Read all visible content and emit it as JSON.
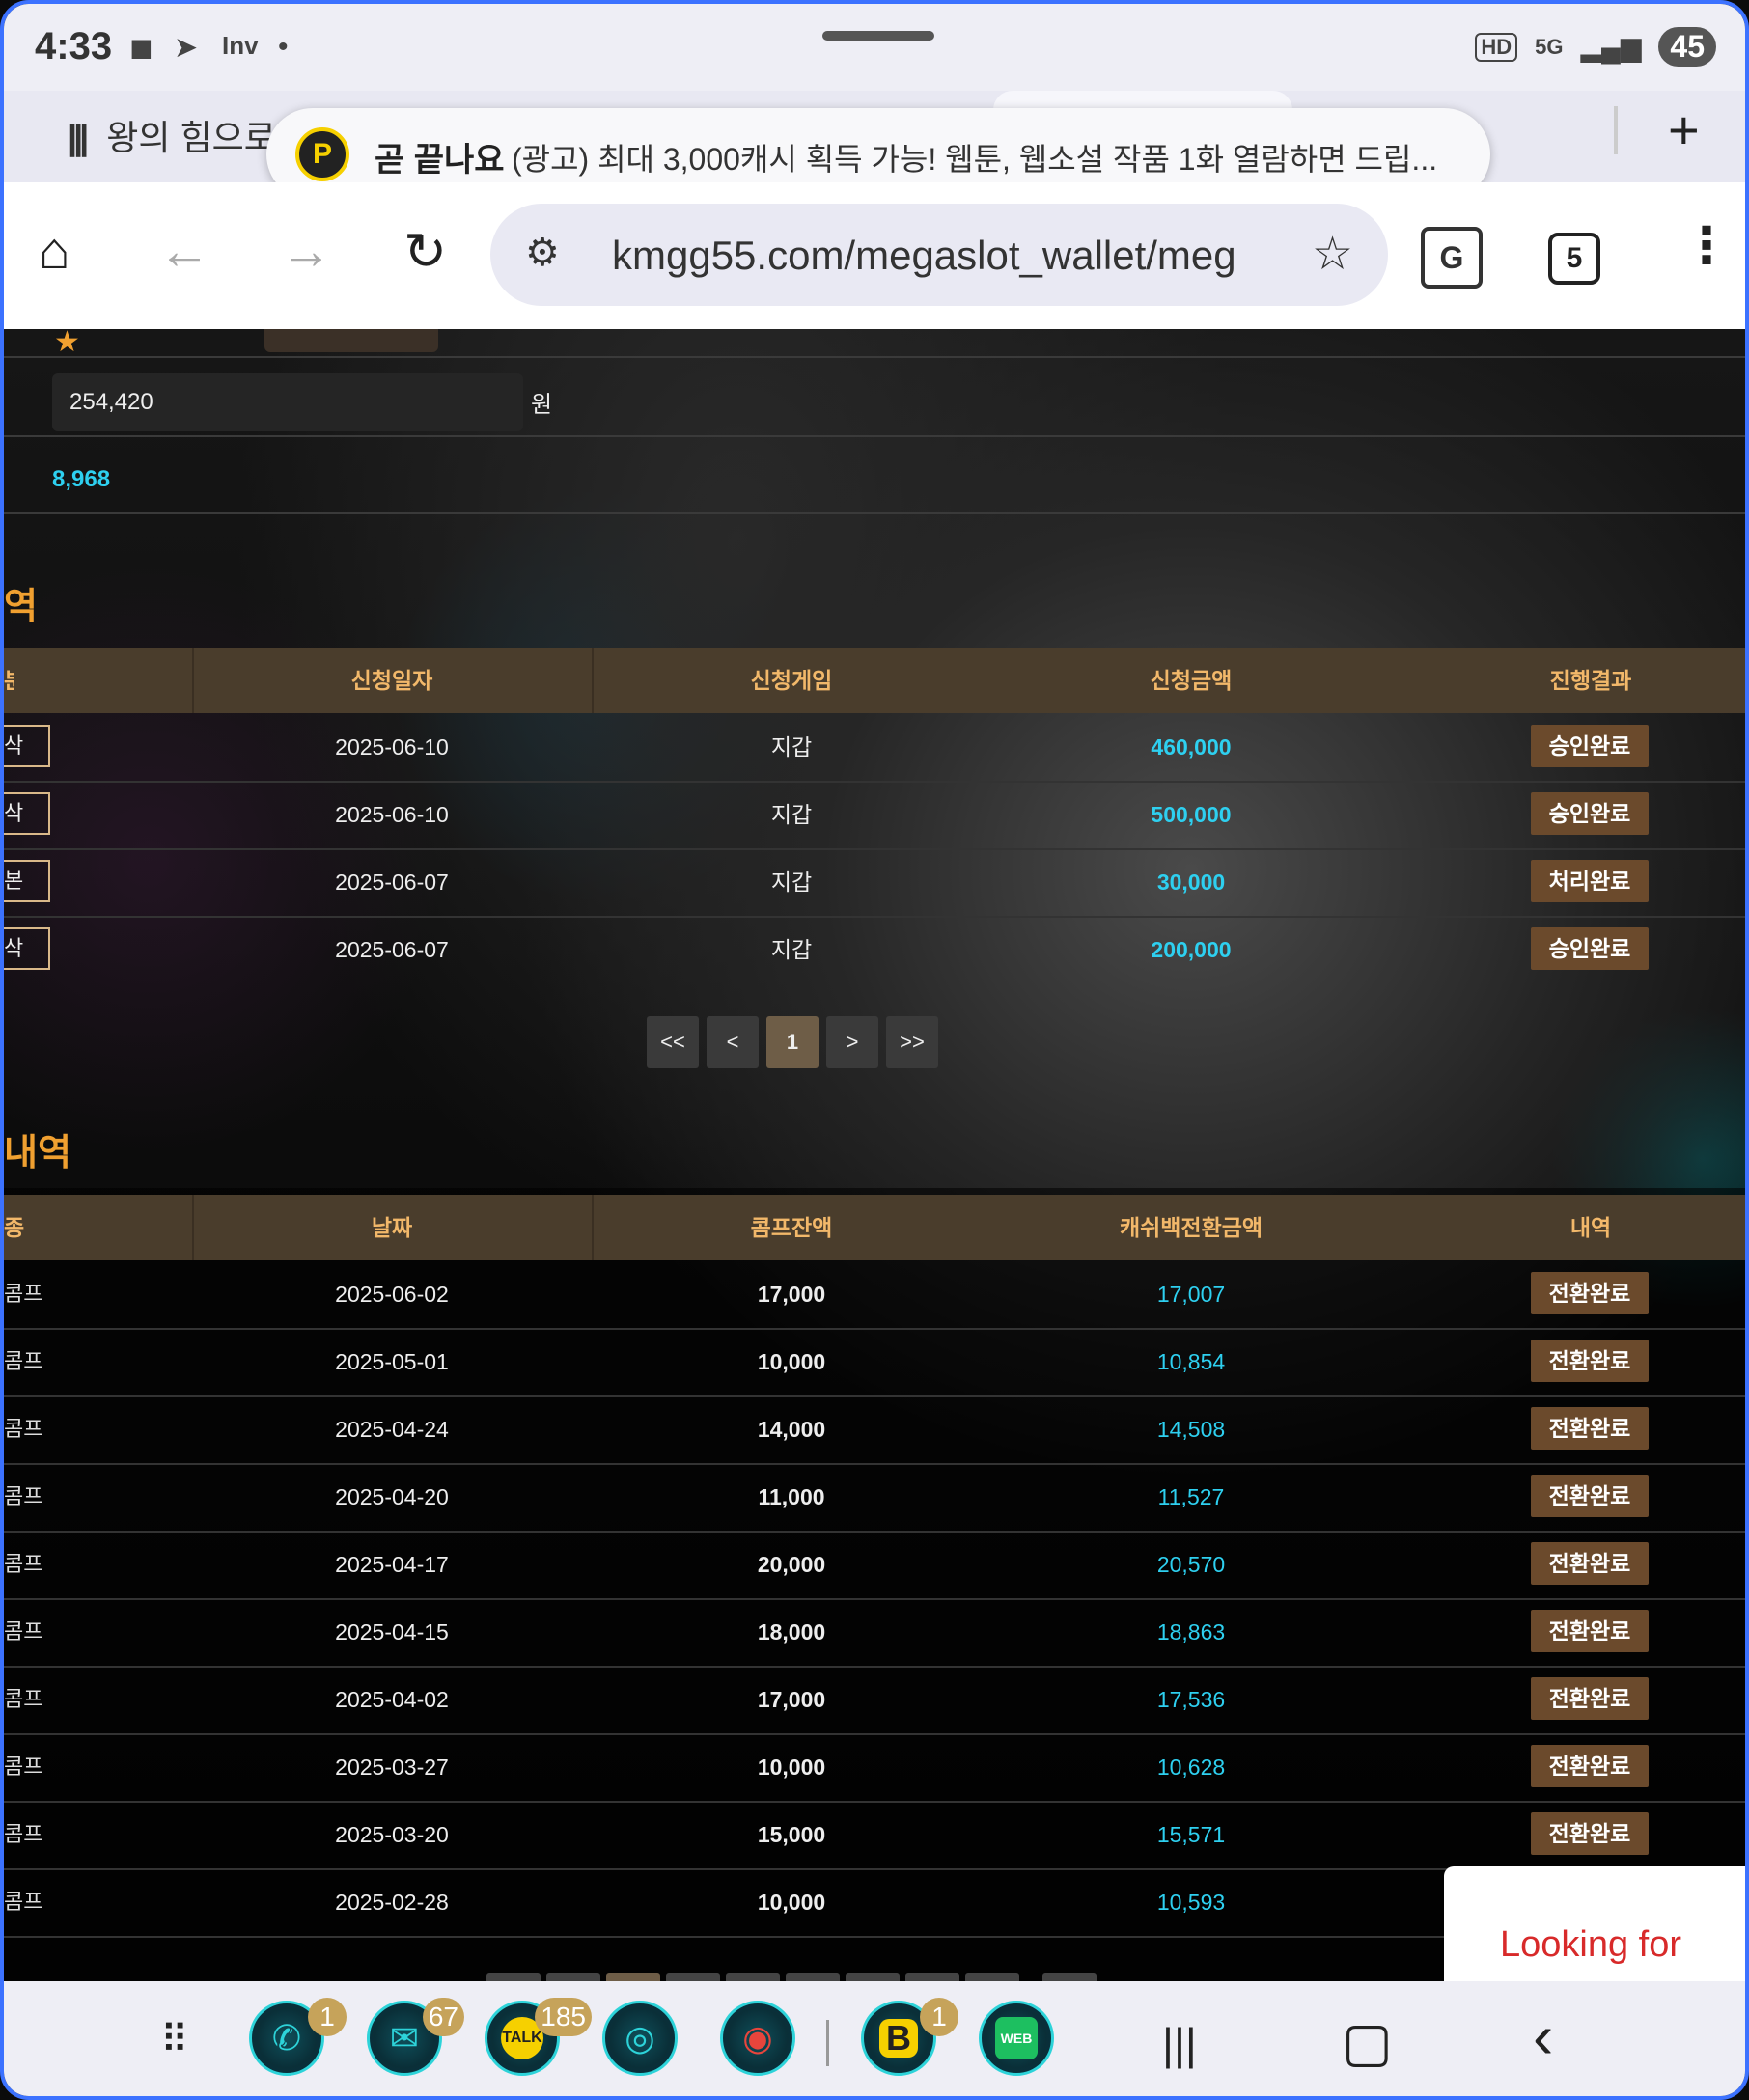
{
  "status_bar": {
    "time": "4:33",
    "left_icons": [
      "notification-square-icon",
      "telegram-icon",
      "inven-icon",
      "dot-icon"
    ],
    "inven_label": "Inv",
    "right_icons": [
      "hd-icon",
      "5g-icon",
      "signal-icon"
    ],
    "hd": "HD",
    "net": "5G",
    "battery": "45"
  },
  "tab": {
    "title": "왕의 힘으로",
    "new_tab": "+"
  },
  "ad": {
    "logo": "P",
    "strong": "곧 끝나요",
    "text": "(광고) 최대 3,000캐시 획득 가능! 웹툰, 웹소설 작품 1화 열람하면 드립..."
  },
  "toolbar": {
    "home": "⌂",
    "back": "←",
    "forward": "→",
    "reload": "↻",
    "url": "kmgg55.com/megaslot_wallet/meg",
    "star": "☆",
    "translate": "G",
    "tabs": "5",
    "menu": "⋮"
  },
  "wallet": {
    "amount": "254,420",
    "currency": "원",
    "point": "8,968"
  },
  "exchange_section": {
    "title_fragment": "역",
    "headers": [
      "분",
      "신청일자",
      "신청게임",
      "신청금액",
      "진행결과"
    ],
    "rows": [
      {
        "type": "삭",
        "date": "2025-06-10",
        "game": "지갑",
        "amount": "460,000",
        "status": "승인완료"
      },
      {
        "type": "삭",
        "date": "2025-06-10",
        "game": "지갑",
        "amount": "500,000",
        "status": "승인완료"
      },
      {
        "type": "본",
        "date": "2025-06-07",
        "game": "지갑",
        "amount": "30,000",
        "status": "처리완료"
      },
      {
        "type": "삭",
        "date": "2025-06-07",
        "game": "지갑",
        "amount": "200,000",
        "status": "승인완료"
      }
    ],
    "pager": [
      "<<",
      "<",
      "1",
      ">",
      ">>"
    ]
  },
  "comp_section": {
    "title_fragment": "내역",
    "headers": [
      "종류",
      "날짜",
      "콤프잔액",
      "캐쉬백전환금액",
      "내역"
    ],
    "rows": [
      {
        "type": "콤프",
        "date": "2025-06-02",
        "balance": "17,000",
        "cashback": "17,007",
        "status": "전환완료"
      },
      {
        "type": "콤프",
        "date": "2025-05-01",
        "balance": "10,000",
        "cashback": "10,854",
        "status": "전환완료"
      },
      {
        "type": "콤프",
        "date": "2025-04-24",
        "balance": "14,000",
        "cashback": "14,508",
        "status": "전환완료"
      },
      {
        "type": "콤프",
        "date": "2025-04-20",
        "balance": "11,000",
        "cashback": "11,527",
        "status": "전환완료"
      },
      {
        "type": "콤프",
        "date": "2025-04-17",
        "balance": "20,000",
        "cashback": "20,570",
        "status": "전환완료"
      },
      {
        "type": "콤프",
        "date": "2025-04-15",
        "balance": "18,000",
        "cashback": "18,863",
        "status": "전환완료"
      },
      {
        "type": "콤프",
        "date": "2025-04-02",
        "balance": "17,000",
        "cashback": "17,536",
        "status": "전환완료"
      },
      {
        "type": "콤프",
        "date": "2025-03-27",
        "balance": "10,000",
        "cashback": "10,628",
        "status": "전환완료"
      },
      {
        "type": "콤프",
        "date": "2025-03-20",
        "balance": "15,000",
        "cashback": "15,571",
        "status": "전환완료"
      },
      {
        "type": "콤프",
        "date": "2025-02-28",
        "balance": "10,000",
        "cashback": "10,593",
        "status": ""
      }
    ]
  },
  "overlay": {
    "looking_for": "Looking for"
  },
  "navbar": {
    "apps_icon": "⠿",
    "apps": [
      {
        "name": "phone-app-icon",
        "symbol": "✆",
        "badge": "1"
      },
      {
        "name": "messages-app-icon",
        "symbol": "✉",
        "badge": "67"
      },
      {
        "name": "kakaotalk-app-icon",
        "symbol": "TALK",
        "badge": "185"
      },
      {
        "name": "browser-app-icon",
        "symbol": "◎",
        "badge": ""
      },
      {
        "name": "chrome-app-icon",
        "symbol": "◉",
        "badge": ""
      },
      {
        "name": "b-app-icon",
        "symbol": "B",
        "badge": "1"
      },
      {
        "name": "webtoon-app-icon",
        "symbol": "WEB",
        "badge": ""
      }
    ],
    "recents": "|||",
    "home": "▢",
    "back": "‹"
  },
  "colors": {
    "accent_cyan": "#2ed0f0",
    "header_gold": "#f2b86a",
    "badge_brown": "#6b4a2c",
    "section_orange": "#f0a030",
    "frame_blue": "#3c72ff"
  }
}
